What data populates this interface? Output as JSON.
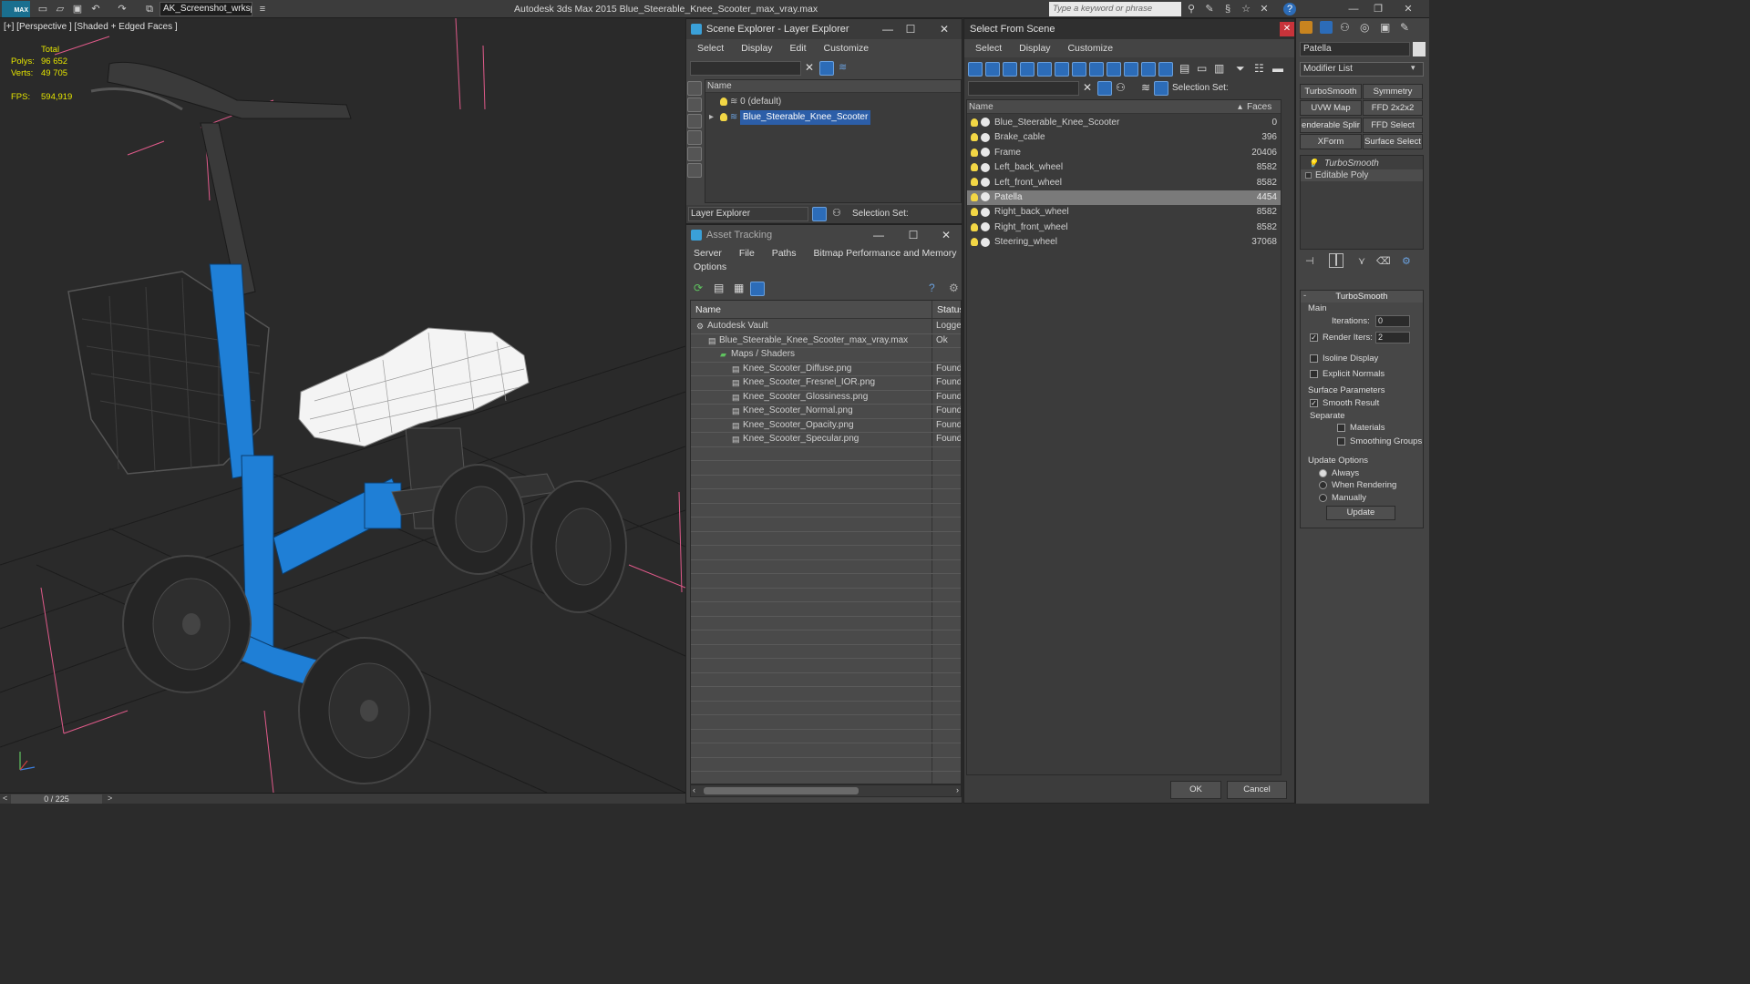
{
  "app": {
    "logo_text": "MAX",
    "workspace": "AK_Screenshot_wrksp",
    "title": "Autodesk 3ds Max  2015      Blue_Steerable_Knee_Scooter_max_vray.max",
    "search_placeholder": "Type a keyword or phrase"
  },
  "viewport": {
    "label": "[+] [Perspective ] [Shaded + Edged Faces ]",
    "stats": {
      "total_label": "Total",
      "polys_label": "Polys:",
      "polys_value": "96 652",
      "verts_label": "Verts:",
      "verts_value": "49 705",
      "fps_label": "FPS:",
      "fps_value": "594,919"
    },
    "timeline": {
      "frame": "0 / 225",
      "prev": "<",
      "next": ">"
    }
  },
  "scene_explorer": {
    "title": "Scene Explorer - Layer Explorer",
    "menu": [
      "Select",
      "Display",
      "Edit",
      "Customize"
    ],
    "column_name": "Name",
    "rows": [
      {
        "label": "0 (default)",
        "selected": false
      },
      {
        "label": "Blue_Steerable_Knee_Scooter",
        "selected": true
      }
    ],
    "footer_dropdown": "Layer Explorer",
    "selection_set_label": "Selection Set:"
  },
  "asset_tracking": {
    "title": "Asset Tracking",
    "menu": [
      "Server",
      "File",
      "Paths",
      "Bitmap Performance and Memory"
    ],
    "menu2": [
      "Options"
    ],
    "col_name": "Name",
    "col_status": "Status",
    "rows": [
      {
        "name": "Autodesk Vault",
        "status": "Logged",
        "indent": 0
      },
      {
        "name": "Blue_Steerable_Knee_Scooter_max_vray.max",
        "status": "Ok",
        "indent": 1
      },
      {
        "name": "Maps / Shaders",
        "status": "",
        "indent": 2
      },
      {
        "name": "Knee_Scooter_Diffuse.png",
        "status": "Found",
        "indent": 3
      },
      {
        "name": "Knee_Scooter_Fresnel_IOR.png",
        "status": "Found",
        "indent": 3
      },
      {
        "name": "Knee_Scooter_Glossiness.png",
        "status": "Found",
        "indent": 3
      },
      {
        "name": "Knee_Scooter_Normal.png",
        "status": "Found",
        "indent": 3
      },
      {
        "name": "Knee_Scooter_Opacity.png",
        "status": "Found",
        "indent": 3
      },
      {
        "name": "Knee_Scooter_Specular.png",
        "status": "Found",
        "indent": 3
      }
    ]
  },
  "select_from_scene": {
    "title": "Select From Scene",
    "menu": [
      "Select",
      "Display",
      "Customize"
    ],
    "selection_set_label": "Selection Set:",
    "col_name": "Name",
    "col_faces": "Faces",
    "rows": [
      {
        "name": "Blue_Steerable_Knee_Scooter",
        "faces": "0",
        "selected": false
      },
      {
        "name": "Brake_cable",
        "faces": "396",
        "selected": false
      },
      {
        "name": "Frame",
        "faces": "20406",
        "selected": false
      },
      {
        "name": "Left_back_wheel",
        "faces": "8582",
        "selected": false
      },
      {
        "name": "Left_front_wheel",
        "faces": "8582",
        "selected": false
      },
      {
        "name": "Patella",
        "faces": "4454",
        "selected": true
      },
      {
        "name": "Right_back_wheel",
        "faces": "8582",
        "selected": false
      },
      {
        "name": "Right_front_wheel",
        "faces": "8582",
        "selected": false
      },
      {
        "name": "Steering_wheel",
        "faces": "37068",
        "selected": false
      }
    ],
    "ok": "OK",
    "cancel": "Cancel"
  },
  "command_panel": {
    "object_name": "Patella",
    "modifier_list": "Modifier List",
    "buttons": [
      "TurboSmooth",
      "Symmetry",
      "UVW Map",
      "FFD 2x2x2",
      "enderable Splir",
      "FFD Select",
      "XForm",
      "Surface Select"
    ],
    "stack": [
      {
        "label": "TurboSmooth",
        "italic": true
      },
      {
        "label": "Editable Poly",
        "italic": false
      }
    ],
    "rollout_title": "TurboSmooth",
    "main_label": "Main",
    "iterations_label": "Iterations:",
    "iterations_value": "0",
    "render_iters_label": "Render Iters:",
    "render_iters_value": "2",
    "isoline_label": "Isoline Display",
    "explicit_normals_label": "Explicit Normals",
    "surface_params_label": "Surface Parameters",
    "smooth_result_label": "Smooth Result",
    "separate_label": "Separate",
    "materials_label": "Materials",
    "smoothing_groups_label": "Smoothing Groups",
    "update_options_label": "Update Options",
    "always_label": "Always",
    "when_rendering_label": "When Rendering",
    "manually_label": "Manually",
    "update_button": "Update"
  },
  "colors": {
    "scooter_blue": "#1f7fd6",
    "selection_blue": "#2c5ea8",
    "stat_yellow": "#e4e400",
    "bound_pink": "#e05a8a"
  }
}
